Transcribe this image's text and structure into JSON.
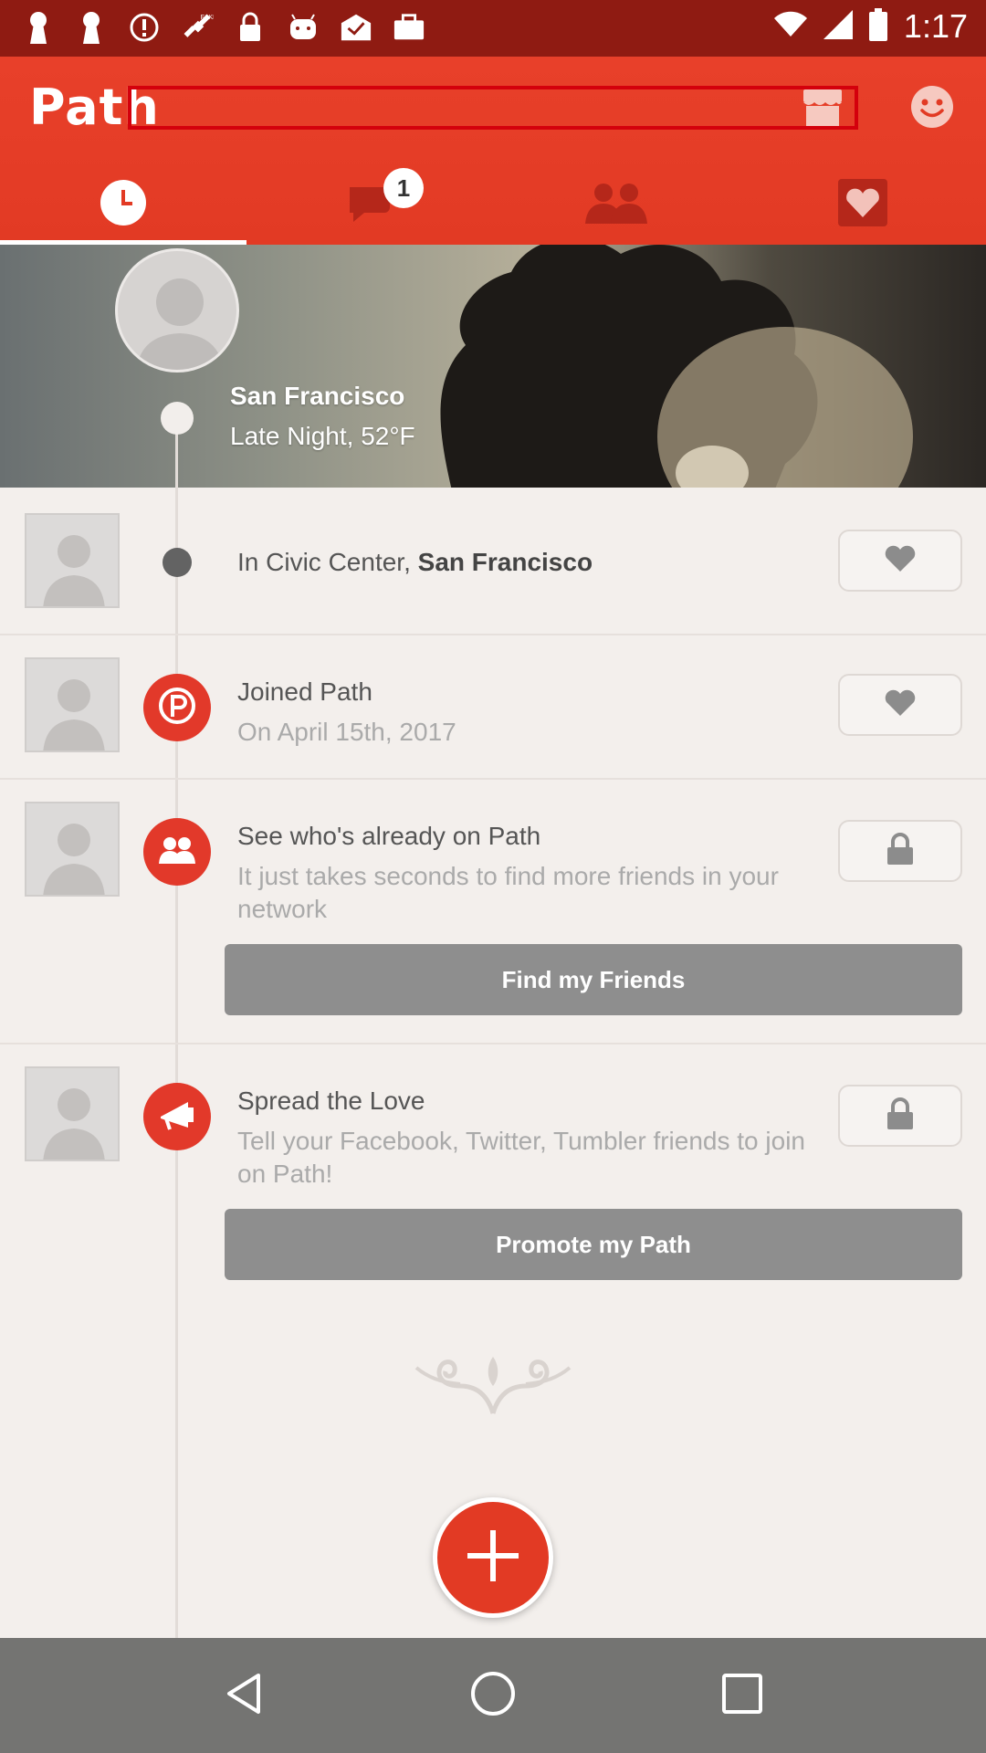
{
  "status_bar": {
    "time": "1:17",
    "icons": [
      "keyhole-icon",
      "keyhole-icon",
      "alert-icon",
      "fake-gps-icon",
      "lock-icon",
      "android-icon",
      "mail-check-icon",
      "briefcase-icon",
      "wifi-icon",
      "signal-icon",
      "battery-icon"
    ]
  },
  "header": {
    "logo": "Path",
    "search_placeholder": "",
    "tabs": [
      {
        "name": "timeline",
        "icon": "clock-icon",
        "active": true
      },
      {
        "name": "messages",
        "icon": "chat-bubble-icon",
        "badge": "1"
      },
      {
        "name": "friends",
        "icon": "people-icon"
      },
      {
        "name": "love",
        "icon": "heart-icon"
      }
    ]
  },
  "cover": {
    "location": "San Francisco",
    "weather": "Late Night, 52°F"
  },
  "moments": [
    {
      "title_prefix": "In Civic Center, ",
      "title_bold": "San Francisco",
      "action": "heart"
    },
    {
      "title": "Joined Path",
      "subtitle": "On April 15th, 2017",
      "action": "heart",
      "node_icon": "path-logo-icon"
    },
    {
      "title": "See who's already on Path",
      "subtitle": "It just takes seconds to find more friends in your network",
      "action": "lock",
      "button": "Find my Friends",
      "node_icon": "people-icon"
    },
    {
      "title": "Spread the Love",
      "subtitle": "Tell your Facebook, Twitter, Tumbler friends to join on Path!",
      "action": "lock",
      "button": "Promote my Path",
      "node_icon": "megaphone-icon"
    }
  ],
  "colors": {
    "brand": "#e23a24",
    "status_bar": "#8f1b12",
    "background": "#f3efec",
    "button_gray": "#8e8e8e",
    "nav_bar": "#747472"
  }
}
